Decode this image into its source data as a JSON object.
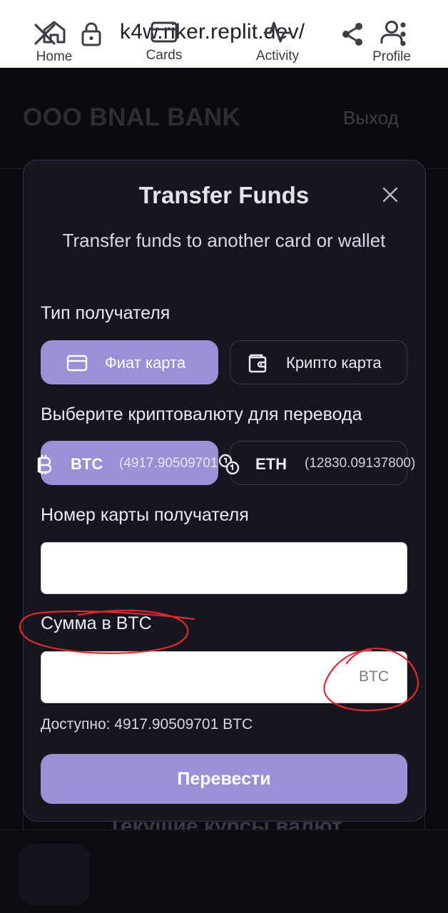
{
  "browser": {
    "url": "k4w.riker.replit.dev/"
  },
  "header": {
    "brand": "OOO BNAL BANK",
    "logout_label": "Выход"
  },
  "modal": {
    "title": "Transfer Funds",
    "subtitle": "Transfer funds to another card or wallet",
    "recipient_type_label": "Тип получателя",
    "recipient_types": [
      {
        "label": "Фиат карта",
        "icon": "credit-card-icon",
        "selected": true
      },
      {
        "label": "Крипто карта",
        "icon": "wallet-icon",
        "selected": false
      }
    ],
    "crypto_label": "Выберите криптовалюту для перевода",
    "cryptos": [
      {
        "name": "BTC",
        "balance": "(4917.90509701",
        "icon": "bitcoin-icon",
        "selected": true
      },
      {
        "name": "ETH",
        "balance": "(12830.09137800)",
        "icon": "coins-icon",
        "selected": false
      }
    ],
    "card_number_label": "Номер карты получателя",
    "card_number_value": "",
    "amount_label": "Сумма в BTC",
    "amount_value": "",
    "amount_suffix": "BTC",
    "available_text": "Доступно: 4917.90509701 BTC",
    "submit_label": "Перевести"
  },
  "background": {
    "rates_heading": "Текущие курсы валют"
  },
  "bottom_nav": {
    "items": [
      {
        "label": "Home",
        "icon": "home-icon",
        "active": true
      },
      {
        "label": "Cards",
        "icon": "credit-card-icon",
        "active": false
      },
      {
        "label": "Activity",
        "icon": "activity-icon",
        "active": false
      },
      {
        "label": "Profile",
        "icon": "user-icon",
        "active": false
      }
    ]
  },
  "colors": {
    "accent": "#9990d6",
    "modal_bg": "#17161f",
    "annotation": "#e0282e"
  }
}
